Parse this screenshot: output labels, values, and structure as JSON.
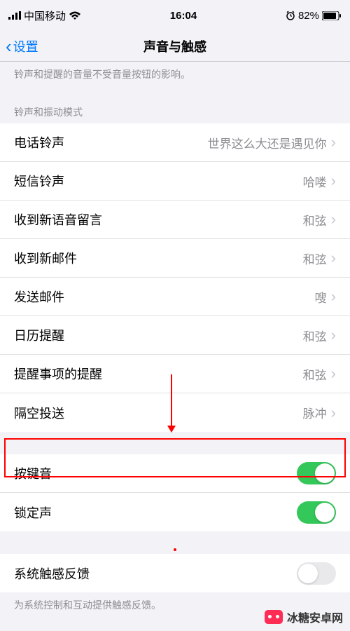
{
  "status": {
    "carrier": "中国移动",
    "time": "16:04",
    "battery": "82%"
  },
  "nav": {
    "back": "设置",
    "title": "声音与触感"
  },
  "note1": "铃声和提醒的音量不受音量按钮的影响。",
  "header1": "铃声和振动模式",
  "rows": [
    {
      "label": "电话铃声",
      "value": "世界这么大还是遇见你"
    },
    {
      "label": "短信铃声",
      "value": "哈喽"
    },
    {
      "label": "收到新语音留言",
      "value": "和弦"
    },
    {
      "label": "收到新邮件",
      "value": "和弦"
    },
    {
      "label": "发送邮件",
      "value": "嗖"
    },
    {
      "label": "日历提醒",
      "value": "和弦"
    },
    {
      "label": "提醒事项的提醒",
      "value": "和弦"
    },
    {
      "label": "隔空投送",
      "value": "脉冲"
    }
  ],
  "toggles": [
    {
      "label": "按键音",
      "on": true
    },
    {
      "label": "锁定声",
      "on": true
    }
  ],
  "haptic": {
    "label": "系统触感反馈",
    "on": false
  },
  "footer": "为系统控制和互动提供触感反馈。",
  "watermark": "冰糖安卓网"
}
